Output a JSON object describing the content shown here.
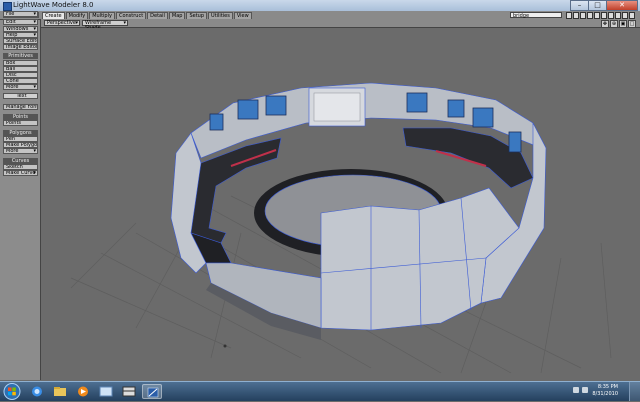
{
  "window": {
    "title": "LightWave Modeler 8.0",
    "controls": {
      "minimize": "–",
      "maximize": "□",
      "close": "✕"
    }
  },
  "menu": {
    "file_label": "File",
    "tabs": [
      "Create",
      "Modify",
      "Multiply",
      "Construct",
      "Detail",
      "Map",
      "Setup",
      "Utilities",
      "View"
    ],
    "active_tab": "Create",
    "layer_select": "bridge"
  },
  "sidebar": {
    "top_buttons": [
      "File",
      "Edit",
      "Windows",
      "Help"
    ],
    "editors": [
      "Surface Editor",
      "Image Editor"
    ],
    "primitives_header": "Primitives",
    "primitives": [
      "Box",
      "Ball",
      "Disc",
      "Cone",
      "More"
    ],
    "text_header": "Text",
    "manage_fonts": "Manage Fonts",
    "points_header": "Points",
    "points": [
      "Points"
    ],
    "polygons_header": "Polygons",
    "polygons": [
      "Pen",
      "Make Polygon",
      "More"
    ],
    "curves_header": "Curves",
    "curves": [
      "Sketch",
      "Make Curve"
    ]
  },
  "viewport": {
    "projection": "Perspective",
    "render_mode": "Wireframe Shade",
    "controls": [
      "✥",
      "⊕",
      "▣",
      "□"
    ]
  },
  "taskbar": {
    "time": "8:35 PM",
    "date": "8/31/2010"
  },
  "colors": {
    "mesh_light": "#c2c7cf",
    "mesh_dark": "#2a2b30",
    "screen_blue": "#3a78c0",
    "wire_blue": "#3b5bd6",
    "accent_red": "#c0304a"
  }
}
